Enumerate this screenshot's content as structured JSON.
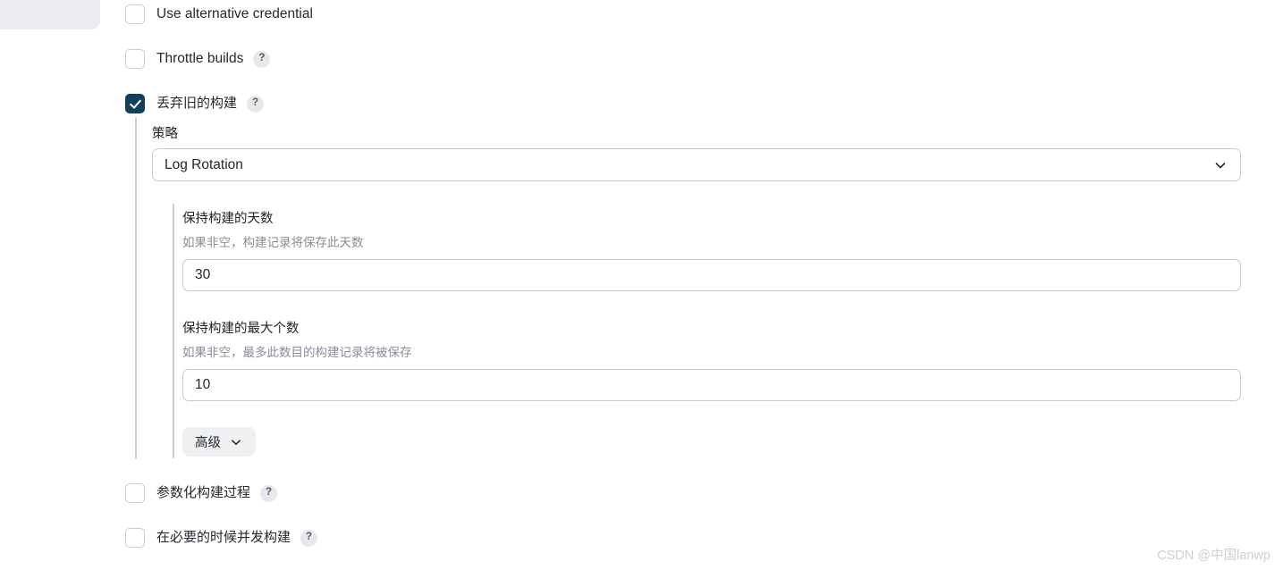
{
  "page": {
    "watermark": "CSDN @中国lanwp"
  },
  "options": [
    {
      "id": "use-alternative-credential",
      "label": "Use alternative credential",
      "checked": false,
      "has_help": false,
      "help_glyph": "?"
    },
    {
      "id": "throttle-builds",
      "label": "Throttle builds",
      "checked": false,
      "has_help": true,
      "help_glyph": "?"
    },
    {
      "id": "discard-old-builds",
      "label": "丢弃旧的构建",
      "checked": true,
      "has_help": true,
      "help_glyph": "?"
    },
    {
      "id": "parameterized-build",
      "label": "参数化构建过程",
      "checked": false,
      "has_help": true,
      "help_glyph": "?"
    },
    {
      "id": "concurrent-builds",
      "label": "在必要的时候并发构建",
      "checked": false,
      "has_help": true,
      "help_glyph": "?"
    }
  ],
  "strategy": {
    "label": "策略",
    "selected": "Log Rotation",
    "options": [
      "Log Rotation"
    ],
    "chevron_icon": "chevron-down-icon"
  },
  "days_to_keep": {
    "label": "保持构建的天数",
    "description": "如果非空，构建记录将保存此天数",
    "value": "30"
  },
  "builds_to_keep": {
    "label": "保持构建的最大个数",
    "description": "如果非空，最多此数目的构建记录将被保存",
    "value": "10"
  },
  "advanced_button": {
    "label": "高级",
    "chevron_icon": "chevron-down-icon"
  },
  "colors": {
    "checkbox_checked": "#11405e",
    "border": "#c3ccd4",
    "muted_text": "#8b8d98",
    "rail": "#c7ced6",
    "button_bg": "#eef0f2",
    "panel_bg": "#ebecf0"
  }
}
